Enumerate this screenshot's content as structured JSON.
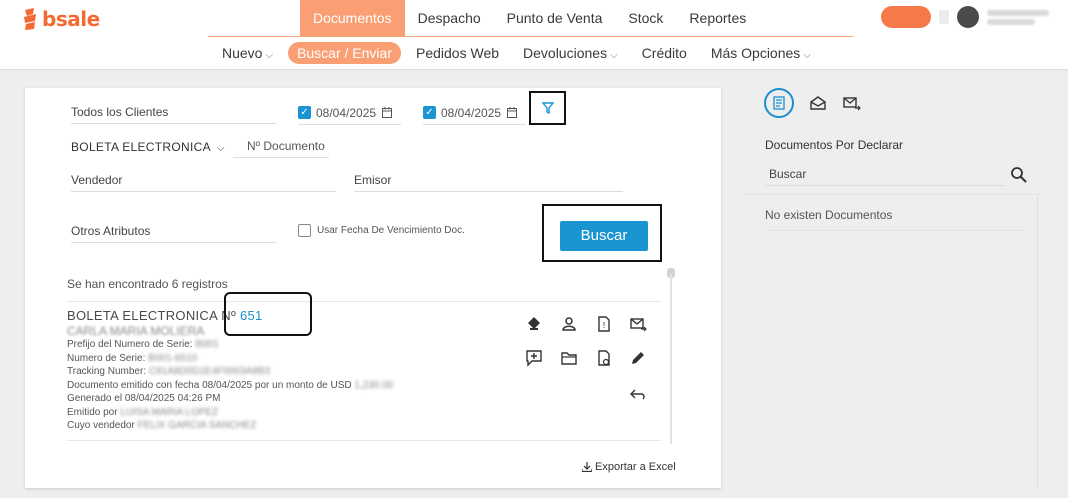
{
  "brand": {
    "name": "bsale",
    "color": "#f46a35"
  },
  "main_tabs": [
    {
      "label": "Documentos",
      "active": true
    },
    {
      "label": "Despacho",
      "active": false
    },
    {
      "label": "Punto de Venta",
      "active": false
    },
    {
      "label": "Stock",
      "active": false
    },
    {
      "label": "Reportes",
      "active": false
    }
  ],
  "sub_tabs": [
    {
      "label": "Nuevo",
      "has_caret": true,
      "active": false
    },
    {
      "label": "Buscar / Enviar",
      "has_caret": false,
      "active": true
    },
    {
      "label": "Pedidos Web",
      "has_caret": false,
      "active": false
    },
    {
      "label": "Devoluciones",
      "has_caret": true,
      "active": false
    },
    {
      "label": "Crédito",
      "has_caret": false,
      "active": false
    },
    {
      "label": "Más Opciones",
      "has_caret": true,
      "active": false
    }
  ],
  "filters": {
    "client": "Todos los Clientes",
    "date_from": "08/04/2025",
    "date_to": "08/04/2025",
    "doc_type": "BOLETA ELECTRONICA",
    "doc_number_placeholder": "Nº Documento",
    "seller_placeholder": "Vendedor",
    "issuer_placeholder": "Emisor",
    "other_attrs": "Otros Atributos",
    "use_due_date": "Usar Fecha De Vencimiento Doc.",
    "search_button": "Buscar"
  },
  "results": {
    "count_text": "Se han encontrado 6 registros",
    "item": {
      "title": "BOLETA ELECTRONICA Nº",
      "number": "651",
      "client": "CARLA MARIA MOLIERA",
      "prefix_label": "Prefijo del Numero de Serie:",
      "prefix_value": "B001",
      "serie_label": "Numero de Serie:",
      "serie_value": "B001-6510",
      "tracking_label": "Tracking Number:",
      "tracking_value": "C91A8D0D1E4F0003A8B3",
      "emitted_text": "Documento emitido con fecha 08/04/2025 por un monto de USD",
      "emitted_value": "1,230.00",
      "generated_text": "Generado el 08/04/2025 04:26 PM",
      "emitted_by_label": "Emitido por",
      "emitted_by_value": "LUISA MARIA LOPEZ",
      "seller_label": "Cuyo vendedor",
      "seller_value": "FELIX GARCIA SANCHEZ"
    },
    "export_label": "Exportar a Excel"
  },
  "side": {
    "title": "Documentos Por Declarar",
    "search_placeholder": "Buscar",
    "empty_text": "No existen Documentos"
  },
  "colors": {
    "accent": "#1a95d2",
    "orange": "#f99f73"
  }
}
